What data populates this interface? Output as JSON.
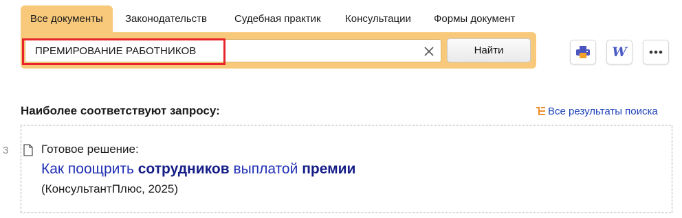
{
  "tabs": [
    {
      "label": "Все документы",
      "active": true
    },
    {
      "label": "Законодательств",
      "active": false
    },
    {
      "label": "Судебная практик",
      "active": false
    },
    {
      "label": "Консультации",
      "active": false
    },
    {
      "label": "Формы документ",
      "active": false
    }
  ],
  "search": {
    "query": "ПРЕМИРОВАНИЕ РАБОТНИКОВ",
    "clear_icon": "close-icon",
    "button_label": "Найти"
  },
  "toolbar": {
    "print_icon": "printer-icon",
    "word_icon": "word-export-icon",
    "word_glyph": "W",
    "more_icon": "more-dots-icon"
  },
  "results": {
    "heading": "Наиболее соответствуют запросу:",
    "all_results_label": "Все результаты поиска",
    "items": [
      {
        "number": "3",
        "type": "Готовое решение:",
        "title_parts": [
          {
            "text": "Как поощрить ",
            "bold": false
          },
          {
            "text": "сотрудников",
            "bold": true
          },
          {
            "text": " выплатой ",
            "bold": false
          },
          {
            "text": "премии",
            "bold": true
          }
        ],
        "source": "(КонсультантПлюс, 2025)"
      }
    ]
  },
  "colors": {
    "accent_orange": "#f8c97a",
    "highlight_red": "#e8232a",
    "link_blue": "#1f2fb3"
  }
}
